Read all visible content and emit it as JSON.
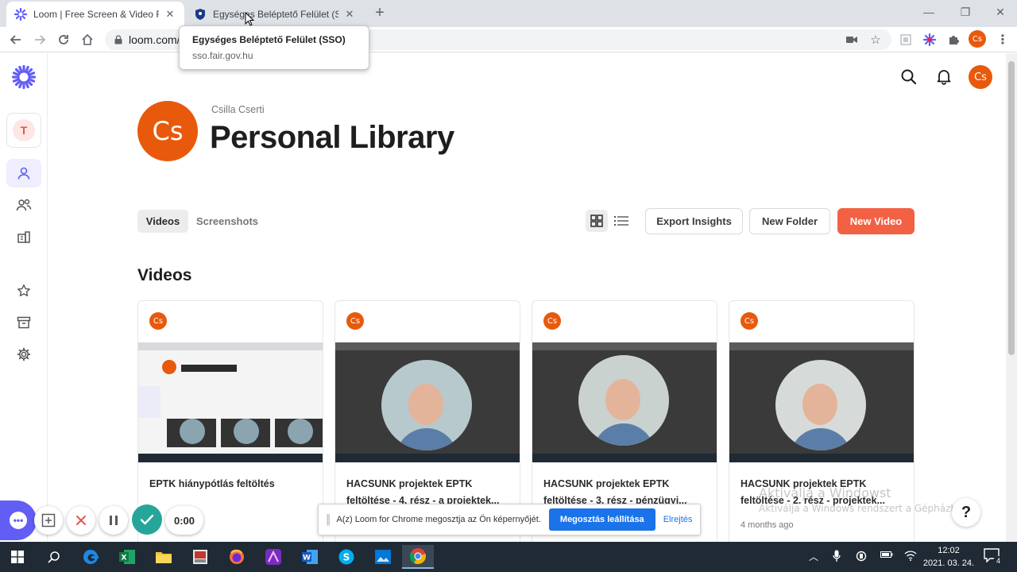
{
  "browser": {
    "tabs": [
      {
        "title": "Loom | Free Screen & Video Recording",
        "active": true
      },
      {
        "title": "Egységes Beléptető Felület (SSO)",
        "active": false
      }
    ],
    "url": "loom.com/",
    "tooltip": {
      "title": "Egységes Beléptető Felület (SSO)",
      "domain": "sso.fair.gov.hu"
    },
    "profile_initials": "Cs"
  },
  "sidebar": {
    "workspace_initial": "T",
    "items": [
      {
        "icon": "person-icon",
        "active": true
      },
      {
        "icon": "people-icon",
        "active": false
      },
      {
        "icon": "building-icon",
        "active": false
      },
      {
        "icon": "star-icon",
        "active": false
      },
      {
        "icon": "archive-icon",
        "active": false
      },
      {
        "icon": "gear-icon",
        "active": false
      }
    ]
  },
  "header": {
    "user_initials": "Cs",
    "owner_name": "Csilla Cserti",
    "library_title": "Personal Library"
  },
  "tabs": {
    "videos": "Videos",
    "screenshots": "Screenshots"
  },
  "actions": {
    "export": "Export Insights",
    "new_folder": "New Folder",
    "new_video": "New Video"
  },
  "section_title": "Videos",
  "videos": [
    {
      "initials": "Cs",
      "title": "EPTK hiánypótlás feltöltés",
      "age": ""
    },
    {
      "initials": "Cs",
      "title": "HACSUNK projektek EPTK feltöltése - 4. rész - a projektek...",
      "age": ""
    },
    {
      "initials": "Cs",
      "title": "HACSUNK projektek EPTK feltöltése - 3. rész - pénzügyi...",
      "age": ""
    },
    {
      "initials": "Cs",
      "title": "HACSUNK projektek EPTK feltöltése - 2. rész - projektek...",
      "age": "4 months ago"
    }
  ],
  "recording": {
    "timer": "0:00"
  },
  "sharebar": {
    "message": "A(z) Loom for Chrome megosztja az Ön képernyőjét.",
    "stop": "Megosztás leállítása",
    "hide": "Elrejtés"
  },
  "watermark": {
    "line1": "Aktiválja a Windowst",
    "line2": "Aktiválja a Windows rendszert a Gépházban"
  },
  "taskbar": {
    "time": "12:02",
    "date": "2021. 03. 24.",
    "notifications": "4"
  },
  "colors": {
    "accent": "#625df5",
    "orange": "#e8590c",
    "new_video": "#f26143",
    "stop_button": "#1a73e8"
  }
}
